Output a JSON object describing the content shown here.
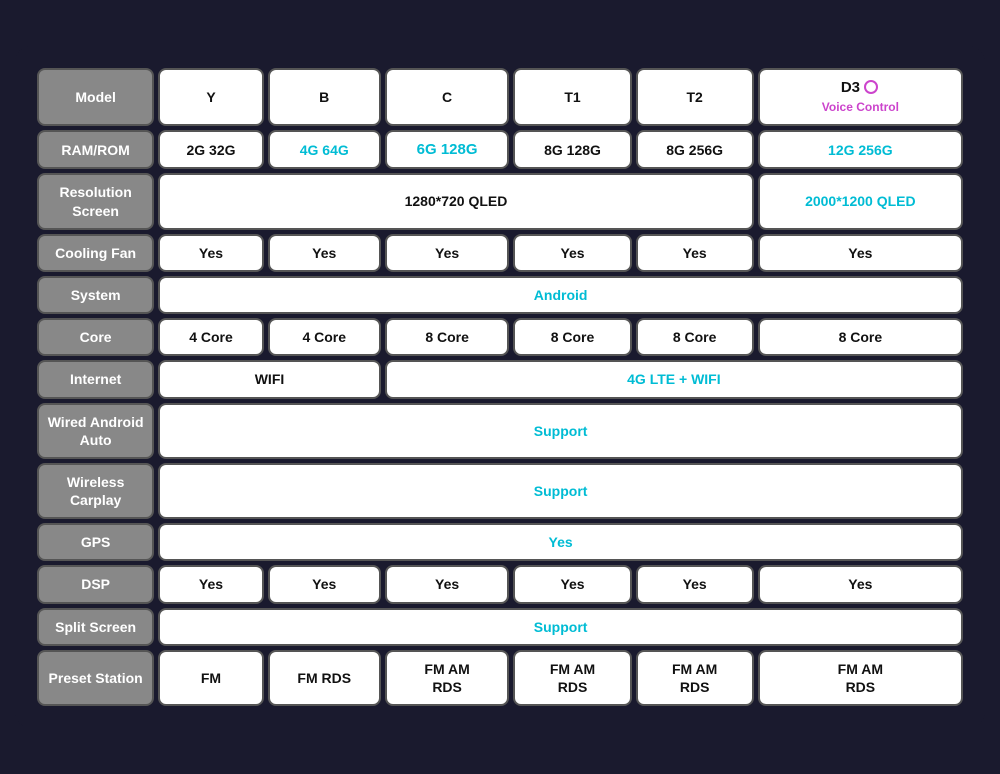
{
  "table": {
    "rows": [
      {
        "label": "Model",
        "cells": [
          "Y",
          "B",
          "C",
          "T1",
          "T2",
          "D3"
        ]
      },
      {
        "label": "RAM/ROM",
        "cells": [
          "2G 32G",
          "4G 64G",
          "6G 128G",
          "8G 128G",
          "8G 256G",
          "12G 256G"
        ]
      },
      {
        "label": "Resolution\nScreen",
        "cells": [
          "1280*720 QLED",
          "2000*1200 QLED"
        ]
      },
      {
        "label": "Cooling Fan",
        "cells": [
          "Yes",
          "Yes",
          "Yes",
          "Yes",
          "Yes",
          "Yes"
        ]
      },
      {
        "label": "System",
        "cells": [
          "Android"
        ]
      },
      {
        "label": "Core",
        "cells": [
          "4 Core",
          "4 Core",
          "8 Core",
          "8 Core",
          "8 Core",
          "8 Core"
        ]
      },
      {
        "label": "Internet",
        "cells": [
          "WIFI",
          "4G LTE + WIFI"
        ]
      },
      {
        "label": "Wired Android\nAuto",
        "cells": [
          "Support"
        ]
      },
      {
        "label": "Wireless\nCarplay",
        "cells": [
          "Support"
        ]
      },
      {
        "label": "GPS",
        "cells": [
          "Yes"
        ]
      },
      {
        "label": "DSP",
        "cells": [
          "Yes",
          "Yes",
          "Yes",
          "Yes",
          "Yes",
          "Yes"
        ]
      },
      {
        "label": "Split Screen",
        "cells": [
          "Support"
        ]
      },
      {
        "label": "Preset Station",
        "cells": [
          "FM",
          "FM RDS",
          "FM AM\nRDS",
          "FM AM\nRDS",
          "FM AM\nRDS",
          "FM AM\nRDS"
        ]
      }
    ]
  }
}
